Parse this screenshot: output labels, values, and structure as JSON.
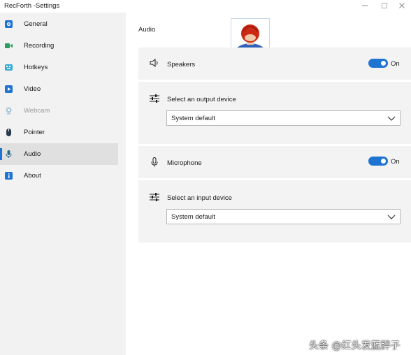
{
  "window": {
    "title": "RecForth -Settings",
    "controls": [
      "minimize-icon",
      "maximize-icon",
      "close-icon"
    ]
  },
  "sidebar": {
    "items": [
      {
        "label": "General",
        "icon": "camera-icon",
        "color": "#1f73d1"
      },
      {
        "label": "Recording",
        "icon": "video-camera-icon",
        "color": "#2e9e5e"
      },
      {
        "label": "Hotkeys",
        "icon": "keyboard-icon",
        "color": "#36a9d6"
      },
      {
        "label": "Video",
        "icon": "video-icon",
        "color": "#1f73d1"
      },
      {
        "label": "Webcam",
        "icon": "webcam-icon",
        "color": "#a9c7dd",
        "disabled": true
      },
      {
        "label": "Pointer",
        "icon": "pointer-icon",
        "color": "#2a3b4d"
      },
      {
        "label": "Audio",
        "icon": "microphone-icon",
        "color": "#2a6c8c",
        "active": true
      },
      {
        "label": "About",
        "icon": "info-icon",
        "color": "#1f73d1"
      }
    ]
  },
  "main": {
    "section_title": "Audio",
    "speakers": {
      "label": "Speakers",
      "toggle_state": "On",
      "enabled": true
    },
    "output_device": {
      "label": "Select an output device",
      "value": "System default"
    },
    "microphone": {
      "label": "Microphone",
      "toggle_state": "On",
      "enabled": true
    },
    "input_device": {
      "label": "Select an input device",
      "value": "System default"
    }
  },
  "watermark": "头条 @红头发蓝胖子",
  "colors": {
    "accent": "#1f73d1",
    "sidebar_bg": "#f2f2f2",
    "card_bg": "#f3f3f3"
  }
}
